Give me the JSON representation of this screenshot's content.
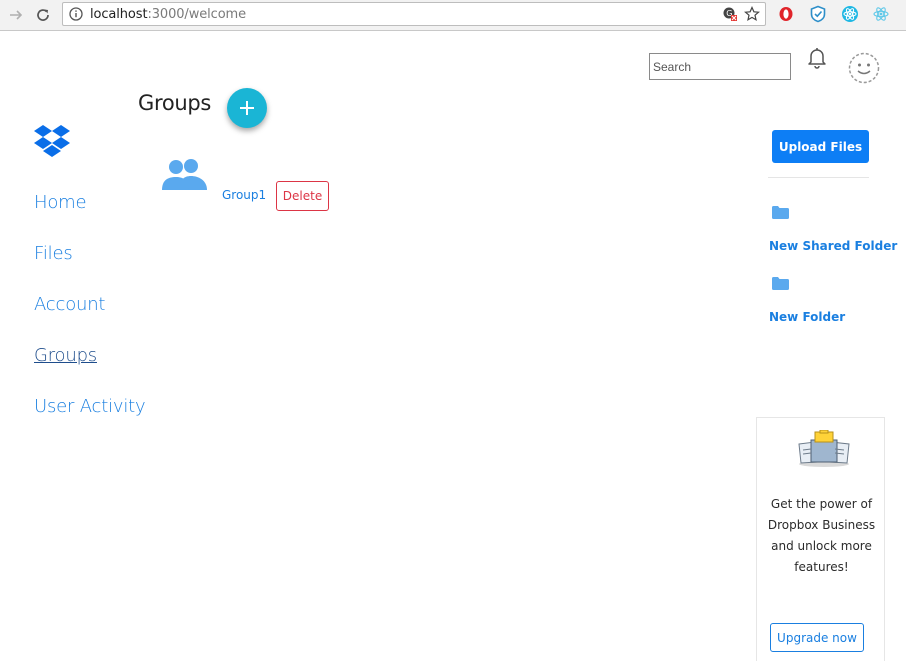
{
  "browser": {
    "url_host": "localhost",
    "url_path": ":3000/welcome"
  },
  "header": {
    "search_placeholder": "Search"
  },
  "sidebar": {
    "items": [
      {
        "label": "Home"
      },
      {
        "label": "Files"
      },
      {
        "label": "Account"
      },
      {
        "label": "Groups",
        "active": true
      },
      {
        "label": "User Activity"
      }
    ]
  },
  "main": {
    "title": "Groups",
    "groups": [
      {
        "name": "Group1",
        "delete_label": "Delete"
      }
    ]
  },
  "right_panel": {
    "upload_label": "Upload Files",
    "folders": [
      {
        "label": "New Shared Folder",
        "icon": "folder-icon"
      },
      {
        "label": "New Folder",
        "icon": "folder-icon"
      }
    ]
  },
  "promo": {
    "text": "Get the power of Dropbox Business and unlock more features!",
    "button_label": "Upgrade now"
  },
  "colors": {
    "link": "#1a7fe0",
    "primary": "#0d7ef5",
    "danger": "#dc3545",
    "fab": "#1ab5d5"
  }
}
